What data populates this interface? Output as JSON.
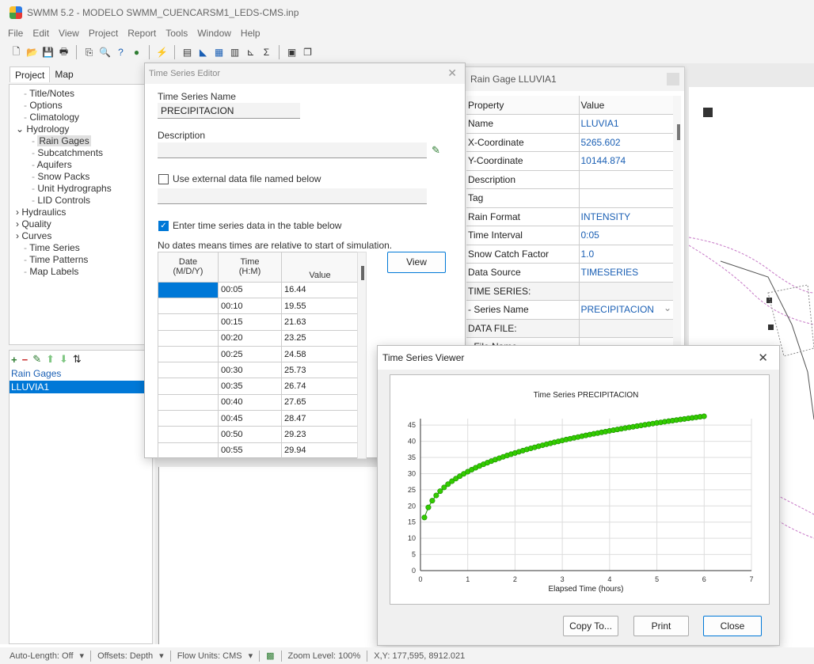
{
  "app": {
    "title": "SWMM 5.2 - MODELO SWMM_CUENCARSM1_LEDS-CMS.inp",
    "menu": [
      "File",
      "Edit",
      "View",
      "Project",
      "Report",
      "Tools",
      "Window",
      "Help"
    ]
  },
  "left_panel": {
    "tabs": [
      "Project",
      "Map"
    ],
    "tree": [
      {
        "label": "Title/Notes",
        "indent": 1
      },
      {
        "label": "Options",
        "indent": 1
      },
      {
        "label": "Climatology",
        "indent": 1
      },
      {
        "label": "Hydrology",
        "indent": 0,
        "expander": "v"
      },
      {
        "label": "Rain Gages",
        "indent": 2,
        "selected": true
      },
      {
        "label": "Subcatchments",
        "indent": 2
      },
      {
        "label": "Aquifers",
        "indent": 2
      },
      {
        "label": "Snow Packs",
        "indent": 2
      },
      {
        "label": "Unit Hydrographs",
        "indent": 2
      },
      {
        "label": "LID Controls",
        "indent": 2
      },
      {
        "label": "Hydraulics",
        "indent": 0,
        "expander": ">"
      },
      {
        "label": "Quality",
        "indent": 0,
        "expander": ">"
      },
      {
        "label": "Curves",
        "indent": 0,
        "expander": ">"
      },
      {
        "label": "Time Series",
        "indent": 1
      },
      {
        "label": "Time Patterns",
        "indent": 1
      },
      {
        "label": "Map Labels",
        "indent": 1
      }
    ],
    "objects_title": "Rain Gages",
    "objects": [
      "LLUVIA1"
    ]
  },
  "time_series_editor": {
    "title": "Time Series Editor",
    "name_label": "Time Series Name",
    "name_value": "PRECIPITACION",
    "description_label": "Description",
    "description_value": "",
    "external_label": "Use external data file named below",
    "external_checked": false,
    "external_value": "",
    "table_label": "Enter time series data in the table below",
    "table_checked": true,
    "note": "No dates means times are relative to start of simulation.",
    "headers": {
      "date": "Date\n(M/D/Y)",
      "time": "Time\n(H:M)",
      "value": "Value"
    },
    "rows": [
      {
        "date": "",
        "time": "00:05",
        "value": "16.44"
      },
      {
        "date": "",
        "time": "00:10",
        "value": "19.55"
      },
      {
        "date": "",
        "time": "00:15",
        "value": "21.63"
      },
      {
        "date": "",
        "time": "00:20",
        "value": "23.25"
      },
      {
        "date": "",
        "time": "00:25",
        "value": "24.58"
      },
      {
        "date": "",
        "time": "00:30",
        "value": "25.73"
      },
      {
        "date": "",
        "time": "00:35",
        "value": "26.74"
      },
      {
        "date": "",
        "time": "00:40",
        "value": "27.65"
      },
      {
        "date": "",
        "time": "00:45",
        "value": "28.47"
      },
      {
        "date": "",
        "time": "00:50",
        "value": "29.23"
      },
      {
        "date": "",
        "time": "00:55",
        "value": "29.94"
      }
    ],
    "view_button": "View"
  },
  "property_editor": {
    "title": "Rain Gage LLUVIA1",
    "header": [
      "Property",
      "Value"
    ],
    "rows": [
      {
        "p": "Name",
        "v": "LLUVIA1"
      },
      {
        "p": "X-Coordinate",
        "v": "5265.602"
      },
      {
        "p": "Y-Coordinate",
        "v": "10144.874"
      },
      {
        "p": "Description",
        "v": ""
      },
      {
        "p": "Tag",
        "v": ""
      },
      {
        "p": "Rain Format",
        "v": "INTENSITY"
      },
      {
        "p": "Time Interval",
        "v": "0:05"
      },
      {
        "p": "Snow Catch Factor",
        "v": "1.0"
      },
      {
        "p": "Data Source",
        "v": "TIMESERIES"
      },
      {
        "p": "TIME SERIES:",
        "v": "",
        "section": true
      },
      {
        "p": " - Series Name",
        "v": "PRECIPITACION"
      },
      {
        "p": "DATA FILE:",
        "v": "",
        "section": true
      },
      {
        "p": " - File Name",
        "v": ""
      }
    ]
  },
  "viewer": {
    "title": "Time Series Viewer",
    "buttons": {
      "copy": "Copy To...",
      "print": "Print",
      "close": "Close"
    }
  },
  "chart_data": {
    "type": "line",
    "title": "Time Series PRECIPITACION",
    "xlabel": "Elapsed Time (hours)",
    "ylabel": "",
    "xlim": [
      0,
      7
    ],
    "ylim": [
      0,
      47
    ],
    "xticks": [
      0,
      1,
      2,
      3,
      4,
      5,
      6,
      7
    ],
    "yticks": [
      0,
      5,
      10,
      15,
      20,
      25,
      30,
      35,
      40,
      45
    ],
    "grid": true,
    "series": [
      {
        "color": "#33cc00",
        "marker": "circle",
        "x_start_hours": 0.0833,
        "x_step_hours": 0.0833,
        "values": [
          16.44,
          19.55,
          21.63,
          23.25,
          24.58,
          25.73,
          26.74,
          27.65,
          28.47,
          29.23,
          29.94,
          30.6,
          31.22,
          31.81,
          32.36,
          32.89,
          33.39,
          33.87,
          34.33,
          34.77,
          35.2,
          35.61,
          36.0,
          36.39,
          36.76,
          37.12,
          37.47,
          37.81,
          38.14,
          38.46,
          38.78,
          39.09,
          39.39,
          39.68,
          39.97,
          40.25,
          40.53,
          40.8,
          41.06,
          41.32,
          41.57,
          41.82,
          42.07,
          42.31,
          42.54,
          42.78,
          43.0,
          43.23,
          43.45,
          43.67,
          43.88,
          44.09,
          44.3,
          44.5,
          44.7,
          44.9,
          45.1,
          45.29,
          45.48,
          45.67,
          45.85,
          46.04,
          46.22,
          46.39,
          46.57,
          46.74,
          46.91,
          47.08,
          47.25,
          47.41,
          47.58,
          47.74
        ]
      }
    ]
  },
  "status_bar": {
    "auto_length": "Auto-Length: Off",
    "offsets": "Offsets: Depth",
    "flow_units": "Flow Units: CMS",
    "zoom": "Zoom Level: 100%",
    "xy": "X,Y: 177,595, 8912.021"
  },
  "colors": {
    "accent": "#0078d7",
    "series": "#33cc00",
    "value_text": "#1a5fb4"
  }
}
